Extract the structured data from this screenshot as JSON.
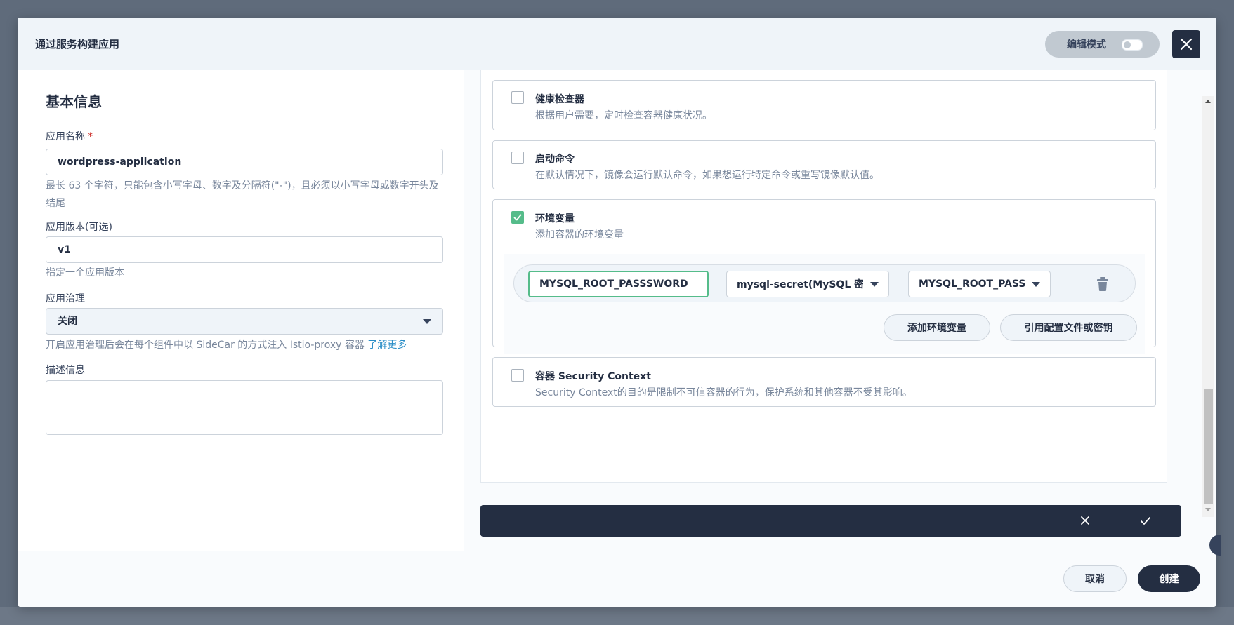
{
  "header": {
    "title": "通过服务构建应用",
    "edit_mode_label": "编辑模式"
  },
  "basic_info": {
    "section_title": "基本信息",
    "app_name": {
      "label": "应用名称",
      "required_mark": "*",
      "value": "wordpress-application",
      "hint": "最长 63 个字符，只能包含小写字母、数字及分隔符(\"-\")，且必须以小写字母或数字开头及结尾"
    },
    "app_version": {
      "label": "应用版本(可选)",
      "value": "v1",
      "hint": "指定一个应用版本"
    },
    "governance": {
      "label": "应用治理",
      "value": "关闭",
      "hint": "开启应用治理后会在每个组件中以 SideCar 的方式注入 Istio-proxy 容器",
      "link": "了解更多"
    },
    "description": {
      "label": "描述信息",
      "value": ""
    }
  },
  "container_settings": {
    "health_checker": {
      "title": "健康检查器",
      "desc": "根据用户需要，定时检查容器健康状况。",
      "checked": false
    },
    "start_command": {
      "title": "启动命令",
      "desc": "在默认情况下，镜像会运行默认命令，如果想运行特定命令或重写镜像默认值。",
      "checked": false
    },
    "env_vars": {
      "title": "环境变量",
      "desc": "添加容器的环境变量",
      "checked": true,
      "rows": [
        {
          "name": "MYSQL_ROOT_PASSSWORD",
          "source": "mysql-secret(MySQL 密钥",
          "key": "MYSQL_ROOT_PASS..."
        }
      ],
      "add_button": "添加环境变量",
      "ref_button": "引用配置文件或密钥"
    },
    "security_context": {
      "title": "容器 Security Context",
      "desc": "Security Context的目的是限制不可信容器的行为，保护系统和其他容器不受其影响。",
      "checked": false
    }
  },
  "footer": {
    "cancel_label": "取消",
    "create_label": "创建"
  },
  "colors": {
    "primary_dark": "#242e42",
    "accent_green": "#55bc8a",
    "link_blue": "#2a8ec7",
    "required_red": "#ca2621"
  }
}
